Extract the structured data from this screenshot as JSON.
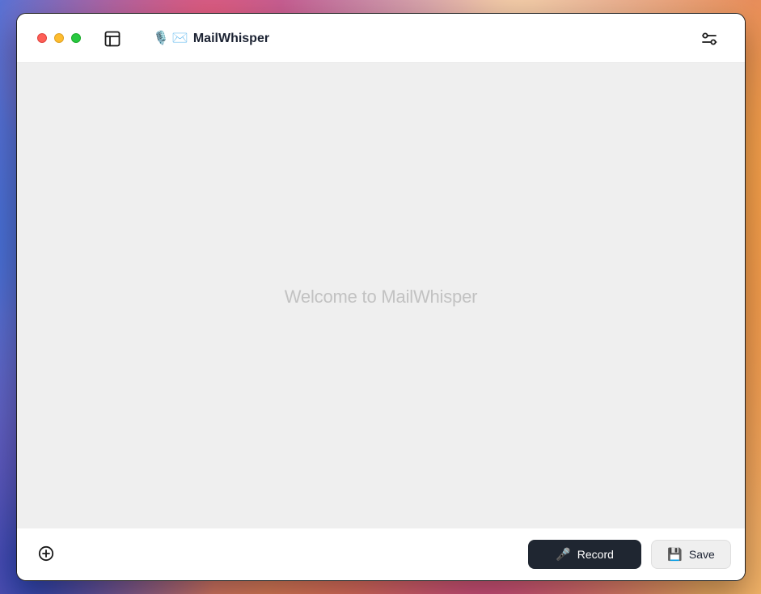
{
  "window": {
    "title_icons": [
      "🎙️",
      "✉️"
    ],
    "title": "MailWhisper"
  },
  "main": {
    "welcome_text": "Welcome to MailWhisper"
  },
  "footer": {
    "record_icon": "🎤",
    "record_label": "Record",
    "save_icon": "💾",
    "save_label": "Save"
  },
  "icons": {
    "sidebar_toggle": "sidebar-toggle-icon",
    "settings": "sliders-icon",
    "add": "plus-circle-icon"
  },
  "colors": {
    "record_button_bg": "#1f2631",
    "content_bg": "#efefef",
    "welcome_text": "#c2c2c2",
    "title_text": "#1c2333"
  }
}
